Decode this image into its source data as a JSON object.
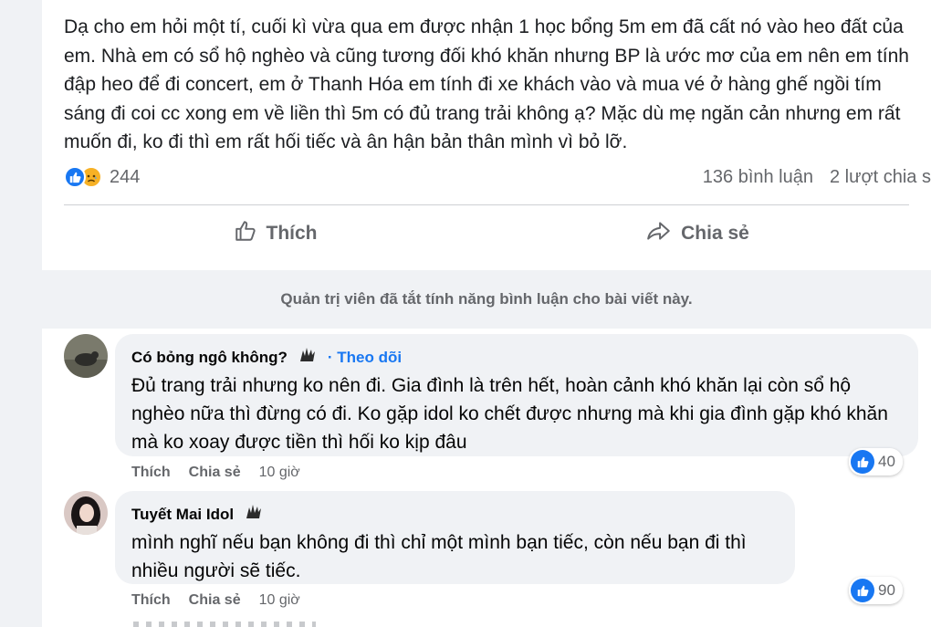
{
  "post": {
    "text": "Dạ cho em hỏi một tí, cuối kì vừa qua em được nhận 1 học bổng 5m em đã cất nó vào heo đất của em. Nhà em có sổ hộ nghèo và cũng tương đối khó khăn nhưng BP là ước mơ của em nên em tính đập heo để đi concert, em ở Thanh Hóa em tính đi xe khách vào và mua vé ở hàng ghế ngồi tím sáng đi coi cc xong em về liền thì 5m có đủ trang trải không ạ? Mặc dù mẹ ngăn cản nhưng em rất muốn đi, ko đi thì em rất hối tiếc và ân hận bản thân mình vì bỏ lỡ."
  },
  "stats": {
    "reaction_count": "244",
    "comments": "136 bình luận",
    "shares": "2 lượt chia s"
  },
  "actions": {
    "like_label": "Thích",
    "share_label": "Chia sẻ"
  },
  "notice": "Quản trị viên đã tắt tính năng bình luận cho bài viết này.",
  "comments": [
    {
      "author": "Có bỏng ngô không?",
      "follow": "· Theo dõi",
      "text": "Đủ trang trải nhưng ko nên đi. Gia đình là trên hết, hoàn cảnh khó khăn lại còn sổ hộ nghèo nữa thì đừng có đi. Ko gặp idol ko chết được nhưng mà khi gia đình gặp khó khăn mà ko xoay được tiền thì hối ko kịp đâu",
      "reactions": "40",
      "like_label": "Thích",
      "share_label": "Chia sẻ",
      "time": "10 giờ"
    },
    {
      "author": "Tuyết Mai Idol",
      "text": "mình nghĩ nếu bạn không đi thì chỉ một mình bạn tiếc, còn nếu bạn đi thì nhiều người sẽ tiếc.",
      "reactions": "90",
      "like_label": "Thích",
      "share_label": "Chia sẻ",
      "time": "10 giờ"
    }
  ],
  "colors": {
    "accent": "#1877f2",
    "muted": "#65676b",
    "bubble": "#f0f2f5"
  },
  "icons": [
    "like-icon",
    "sad-icon",
    "thumbs-up-outline-icon",
    "share-arrow-icon",
    "fan-badge-icon"
  ]
}
